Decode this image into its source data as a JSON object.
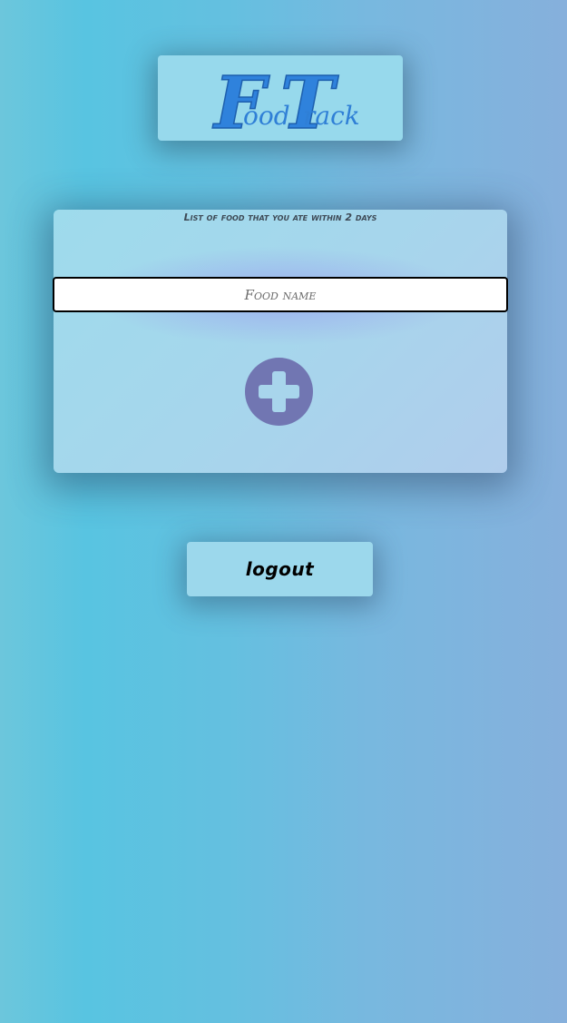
{
  "logo": {
    "letter_1": "F",
    "rest_1": "ood",
    "letter_2": "T",
    "rest_2": "rack"
  },
  "food_list": {
    "title": "List of food that you ate within 2 days",
    "input": {
      "placeholder": "Food name",
      "value": ""
    },
    "add_button_icon": "plus-circle-icon"
  },
  "logout": {
    "label": "logout"
  },
  "colors": {
    "logo_blue": "#2f82dc",
    "add_button": "#7176b2",
    "card_bg": "#a6d6ec"
  }
}
